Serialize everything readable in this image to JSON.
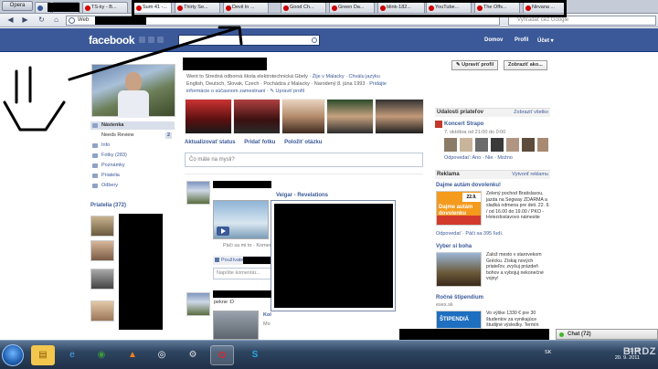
{
  "browser": {
    "menu_label": "Opera",
    "tabs": [
      {
        "label": "",
        "color": "#3b5998"
      },
      {
        "label": "",
        "color": "#3b5998"
      },
      {
        "label": "TS-ky - B...",
        "color": "#d40000"
      },
      {
        "label": "Sum 41 -...",
        "color": "#cc0000"
      },
      {
        "label": "Thirty Se...",
        "color": "#cc0000"
      },
      {
        "label": "Devil In ...",
        "color": "#cc0000"
      },
      {
        "label": "Good Ch...",
        "color": "#cc0000"
      },
      {
        "label": "Green Da...",
        "color": "#cc0000"
      },
      {
        "label": "blink-182...",
        "color": "#cc0000"
      },
      {
        "label": "YouTube...",
        "color": "#cc0000"
      },
      {
        "label": "The Offs...",
        "color": "#cc0000"
      },
      {
        "label": "Nirvana ...",
        "color": "#cc0000"
      }
    ],
    "address_label": "Web",
    "search_placeholder": "Vyhľadať cez Google"
  },
  "facebook": {
    "logo": "facebook",
    "nav": {
      "home": "Domov",
      "profile": "Profil",
      "account": "Účet ▾"
    },
    "buttons": {
      "edit_profile": "✎ Upraviť profil",
      "show_as": "Zobraziť ako..."
    },
    "info": {
      "line1_school": "Went to Stredná odborná škola elektrotechnická Gbely",
      "line1_lives": "Žije v Malacky",
      "line1_from": "Chválu jazyku",
      "line2": "English, Deutsch, Slovak, Czech",
      "line2_from": "Pochádza z Malacky",
      "line2_born": "Narodený 8. júna 1993",
      "line2_add": "Pridajte",
      "line3": "informácie o súčasnom zamestnaní",
      "line3_edit": "✎ Upraviť profil"
    },
    "left_nav": [
      {
        "label": "Nástenka",
        "count": ""
      },
      {
        "label": "Needs Review",
        "count": "2"
      },
      {
        "label": "Info",
        "count": ""
      },
      {
        "label": "Fotky (283)",
        "count": ""
      },
      {
        "label": "Poznámky",
        "count": ""
      },
      {
        "label": "Priatelia",
        "count": ""
      },
      {
        "label": "Odbery",
        "count": ""
      }
    ],
    "friends_header": "Priatelia (372)",
    "composer": {
      "status": "Aktualizovať status",
      "photo": "Pridať fotku",
      "question": "Položiť otázku",
      "placeholder": "Čo máte na mysli?"
    },
    "post": {
      "video_title": "Veigar - Revelations",
      "meta": "Páči sa mi to · Komen",
      "likes": "Používatelov",
      "comment_placeholder": "Napíšte komentár..."
    },
    "post2": {
      "text": "pekne :D",
      "label": "Kol",
      "label2": "Mo"
    },
    "right": {
      "events_header": "Udalosti priateľov",
      "events_link": "Zobraziť všetko",
      "event_title": "Koncert Strapo",
      "event_date": "7. októbra od 21:00 do 0:00",
      "event_rsvp": "Odpovedať: Áno · Nie · Možno",
      "ads_header": "Reklama",
      "ads_link": "Vytvoriť reklamu",
      "ad1_title": "Dajme autám dovolenku!",
      "ad1_img_text": "Dajme autám dovolenku",
      "ad1_badge": "22.9.",
      "ad1_text": "Zelený pochod Bratislavou, jazda na Segway ZDARMA a sladká odmena pre deti. 22. 9. / od 16.00 do 19.00 / PKO - Hviezdoslavovo námestie",
      "ad1_like": "Odpovedať · Páči sa 395 ľudí.",
      "ad2_title": "Vyber si boha",
      "ad2_text": "Založ mesto v starovekom Grécku. Získaj nových priateľov, zvyšuj prázdeň bohov a vybojuj nekonečné vojny!",
      "ad3_title": "Ročné štipendium",
      "ad3_sub": "esex.sk",
      "ad3_img_text": "ŠTIPENDIÁ",
      "ad3_text": "Vo výške 1330 € pre 30 študentov za vynikajúce študijné výsledky. Termín"
    },
    "chat": "Chat (72)"
  },
  "taskbar": {
    "lang": "SK",
    "time": "15:14",
    "date": "20. 9. 2011",
    "watermark": "BIRDZ",
    "apps": [
      "explorer-icon",
      "ie-icon",
      "chrome-icon",
      "vlc-icon",
      "hp-icon",
      "steam-icon",
      "opera-icon",
      "skype-icon"
    ]
  },
  "colors": {
    "facebook_blue": "#3b5998",
    "link": "#3b5998",
    "redaction": "#000000"
  }
}
